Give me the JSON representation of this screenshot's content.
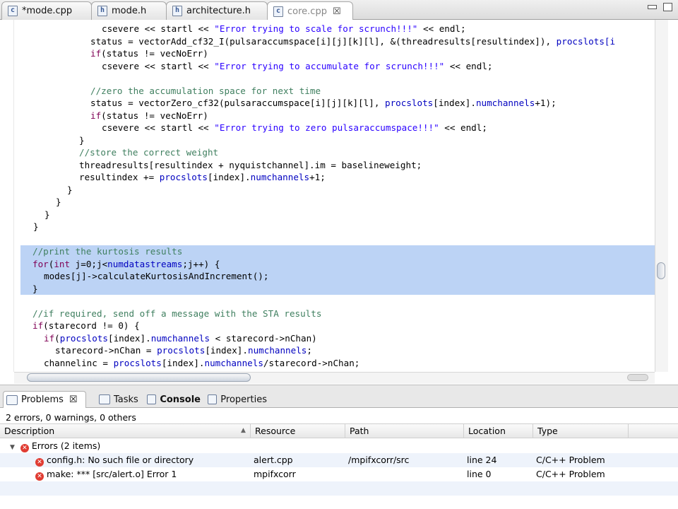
{
  "editor_tabs": [
    {
      "label": "*mode.cpp",
      "icon": "c-source-file-icon",
      "icon_glyph": "c"
    },
    {
      "label": "mode.h",
      "icon": "header-file-icon",
      "icon_glyph": "h"
    },
    {
      "label": "architecture.h",
      "icon": "header-file-icon",
      "icon_glyph": "h"
    },
    {
      "label": "core.cpp",
      "icon": "c-source-file-icon",
      "icon_glyph": "c",
      "close": "☒"
    }
  ],
  "code_lines": [
    {
      "indent": "      ",
      "parts": [
        [
          "t",
          "csevere << startl << "
        ],
        [
          "s",
          "\"Error trying to scale for scrunch!!!\""
        ],
        [
          "t",
          " << endl;"
        ]
      ]
    },
    {
      "indent": "    ",
      "parts": [
        [
          "t",
          "status = vectorAdd_cf32_I(pulsaraccumspace[i][j][k][l], &(threadresults[resultindex]), "
        ],
        [
          "f",
          "procslots[i"
        ]
      ]
    },
    {
      "indent": "    ",
      "parts": [
        [
          "k",
          "if"
        ],
        [
          "t",
          "(status != vecNoErr)"
        ]
      ]
    },
    {
      "indent": "      ",
      "parts": [
        [
          "t",
          "csevere << startl << "
        ],
        [
          "s",
          "\"Error trying to accumulate for scrunch!!!\""
        ],
        [
          "t",
          " << endl;"
        ]
      ]
    },
    {
      "indent": "",
      "parts": []
    },
    {
      "indent": "    ",
      "parts": [
        [
          "c",
          "//zero the accumulation space for next time"
        ]
      ]
    },
    {
      "indent": "    ",
      "parts": [
        [
          "t",
          "status = vectorZero_cf32(pulsaraccumspace[i][j][k][l], "
        ],
        [
          "f",
          "procslots"
        ],
        [
          "t",
          "[index]."
        ],
        [
          "f",
          "numchannels"
        ],
        [
          "t",
          "+1);"
        ]
      ]
    },
    {
      "indent": "    ",
      "parts": [
        [
          "k",
          "if"
        ],
        [
          "t",
          "(status != vecNoErr)"
        ]
      ]
    },
    {
      "indent": "      ",
      "parts": [
        [
          "t",
          "csevere << startl << "
        ],
        [
          "s",
          "\"Error trying to zero pulsaraccumspace!!!\""
        ],
        [
          "t",
          " << endl;"
        ]
      ]
    },
    {
      "indent": "  ",
      "parts": [
        [
          "t",
          "}"
        ]
      ]
    },
    {
      "indent": "  ",
      "parts": [
        [
          "c",
          "//store the correct weight"
        ]
      ]
    },
    {
      "indent": "  ",
      "parts": [
        [
          "t",
          "threadresults[resultindex + nyquistchannel].im = baselineweight;"
        ]
      ]
    },
    {
      "indent": "  ",
      "parts": [
        [
          "t",
          "resultindex += "
        ],
        [
          "f",
          "procslots"
        ],
        [
          "t",
          "[index]."
        ],
        [
          "f",
          "numchannels"
        ],
        [
          "t",
          "+1;"
        ]
      ]
    },
    {
      "indent": "",
      "parts": [
        [
          "t",
          "}"
        ]
      ],
      "x": 95
    },
    {
      "indent": "",
      "parts": [
        [
          "t",
          "}"
        ]
      ],
      "x": 79
    },
    {
      "indent": "",
      "parts": [
        [
          "t",
          "}"
        ]
      ],
      "x": 63
    },
    {
      "indent": "",
      "parts": [
        [
          "t",
          "}"
        ]
      ],
      "x": 47
    },
    {
      "indent": "",
      "parts": []
    },
    {
      "indent": "",
      "parts": [
        [
          "c",
          "//print the kurtosis results"
        ]
      ],
      "sel": true
    },
    {
      "indent": "",
      "parts": [
        [
          "k",
          "for"
        ],
        [
          "t",
          "("
        ],
        [
          "k",
          "int"
        ],
        [
          "t",
          " j=0;j<"
        ],
        [
          "f",
          "numdatastreams"
        ],
        [
          "t",
          ";j++) {"
        ]
      ],
      "sel": true
    },
    {
      "indent": "  ",
      "parts": [
        [
          "t",
          "modes[j]->calculateKurtosisAndIncrement();"
        ]
      ],
      "sel": true
    },
    {
      "indent": "",
      "parts": [
        [
          "t",
          "}"
        ]
      ],
      "sel": true
    },
    {
      "indent": "",
      "parts": []
    },
    {
      "indent": "",
      "parts": [
        [
          "c",
          "//if required, send off a message with the STA results"
        ]
      ]
    },
    {
      "indent": "",
      "parts": [
        [
          "k",
          "if"
        ],
        [
          "t",
          "(starecord != 0) {"
        ]
      ]
    },
    {
      "indent": "  ",
      "parts": [
        [
          "k",
          "if"
        ],
        [
          "t",
          "("
        ],
        [
          "f",
          "procslots"
        ],
        [
          "t",
          "[index]."
        ],
        [
          "f",
          "numchannels"
        ],
        [
          "t",
          " < starecord->nChan)"
        ]
      ]
    },
    {
      "indent": "    ",
      "parts": [
        [
          "t",
          "starecord->nChan = "
        ],
        [
          "f",
          "procslots"
        ],
        [
          "t",
          "[index]."
        ],
        [
          "f",
          "numchannels"
        ],
        [
          "t",
          ";"
        ]
      ]
    },
    {
      "indent": "  ",
      "parts": [
        [
          "t",
          "channelinc = "
        ],
        [
          "f",
          "procslots"
        ],
        [
          "t",
          "[index]."
        ],
        [
          "f",
          "numchannels"
        ],
        [
          "t",
          "/starecord->nChan;"
        ]
      ]
    }
  ],
  "view_tabs": [
    {
      "label": "Problems",
      "icon": "problems-icon",
      "active": true
    },
    {
      "label": "Tasks",
      "icon": "tasks-icon"
    },
    {
      "label": "Console",
      "icon": "console-icon"
    },
    {
      "label": "Properties",
      "icon": "properties-icon"
    }
  ],
  "problems": {
    "summary": "2 errors, 0 warnings, 0 others",
    "columns": [
      "Description",
      "Resource",
      "Path",
      "Location",
      "Type"
    ],
    "group_label": "Errors (2 items)",
    "rows": [
      {
        "description": "config.h: No such file or directory",
        "resource": "alert.cpp",
        "path": "/mpifxcorr/src",
        "location": "line 24",
        "type": "C/C++ Problem"
      },
      {
        "description": "make: *** [src/alert.o] Error 1",
        "resource": "mpifxcorr",
        "path": "",
        "location": "line 0",
        "type": "C/C++ Problem"
      }
    ]
  },
  "colors": {
    "keyword": "#7f0055",
    "string": "#2a00ff",
    "comment": "#3f7f5f",
    "field": "#0000c0",
    "selection": "#bcd3f5",
    "error": "#e03c32"
  }
}
